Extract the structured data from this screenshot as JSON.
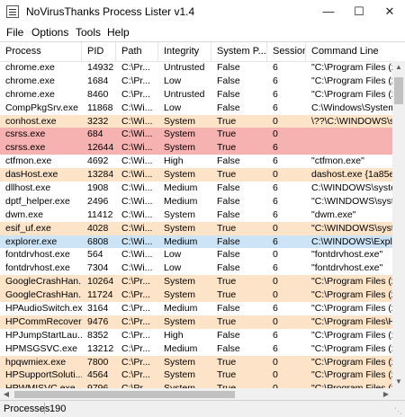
{
  "window": {
    "title": "NoVirusThanks Process Lister v1.4"
  },
  "menu": [
    "File",
    "Options",
    "Tools",
    "Help"
  ],
  "columns": [
    "Process",
    "PID",
    "Path",
    "Integrity",
    "System P...",
    "Session",
    "Command Line"
  ],
  "rows": [
    {
      "cells": [
        "chrome.exe",
        "14932",
        "C:\\Pr...",
        "Untrusted",
        "False",
        "6",
        "\"C:\\Program Files (x8"
      ],
      "hl": ""
    },
    {
      "cells": [
        "chrome.exe",
        "1684",
        "C:\\Pr...",
        "Low",
        "False",
        "6",
        "\"C:\\Program Files (x8"
      ],
      "hl": ""
    },
    {
      "cells": [
        "chrome.exe",
        "8460",
        "C:\\Pr...",
        "Untrusted",
        "False",
        "6",
        "\"C:\\Program Files (x8"
      ],
      "hl": ""
    },
    {
      "cells": [
        "CompPkgSrv.exe",
        "11868",
        "C:\\Wi...",
        "Low",
        "False",
        "6",
        "C:\\Windows\\System"
      ],
      "hl": ""
    },
    {
      "cells": [
        "conhost.exe",
        "3232",
        "C:\\Wi...",
        "System",
        "True",
        "0",
        "\\??\\C:\\WINDOWS\\sy"
      ],
      "hl": "orange"
    },
    {
      "cells": [
        "csrss.exe",
        "684",
        "C:\\Wi...",
        "System",
        "True",
        "0",
        ""
      ],
      "hl": "red"
    },
    {
      "cells": [
        "csrss.exe",
        "12644",
        "C:\\Wi...",
        "System",
        "True",
        "6",
        ""
      ],
      "hl": "red"
    },
    {
      "cells": [
        "ctfmon.exe",
        "4692",
        "C:\\Wi...",
        "High",
        "False",
        "6",
        "\"ctfmon.exe\""
      ],
      "hl": ""
    },
    {
      "cells": [
        "dasHost.exe",
        "13284",
        "C:\\Wi...",
        "System",
        "True",
        "0",
        "dashost.exe {1a85e"
      ],
      "hl": "orange"
    },
    {
      "cells": [
        "dllhost.exe",
        "1908",
        "C:\\Wi...",
        "Medium",
        "False",
        "6",
        "C:\\WINDOWS\\syster"
      ],
      "hl": ""
    },
    {
      "cells": [
        "dptf_helper.exe",
        "2496",
        "C:\\Wi...",
        "Medium",
        "False",
        "6",
        "\"C:\\WINDOWS\\syster"
      ],
      "hl": ""
    },
    {
      "cells": [
        "dwm.exe",
        "11412",
        "C:\\Wi...",
        "System",
        "False",
        "6",
        "\"dwm.exe\""
      ],
      "hl": ""
    },
    {
      "cells": [
        "esif_uf.exe",
        "4028",
        "C:\\Wi...",
        "System",
        "True",
        "0",
        "\"C:\\WINDOWS\\syster"
      ],
      "hl": "orange"
    },
    {
      "cells": [
        "explorer.exe",
        "6808",
        "C:\\Wi...",
        "Medium",
        "False",
        "6",
        "C:\\WINDOWS\\Explor"
      ],
      "hl": "blue"
    },
    {
      "cells": [
        "fontdrvhost.exe",
        "564",
        "C:\\Wi...",
        "Low",
        "False",
        "0",
        "\"fontdrvhost.exe\""
      ],
      "hl": ""
    },
    {
      "cells": [
        "fontdrvhost.exe",
        "7304",
        "C:\\Wi...",
        "Low",
        "False",
        "6",
        "\"fontdrvhost.exe\""
      ],
      "hl": ""
    },
    {
      "cells": [
        "GoogleCrashHan...",
        "10264",
        "C:\\Pr...",
        "System",
        "True",
        "0",
        "\"C:\\Program Files (x8"
      ],
      "hl": "orange"
    },
    {
      "cells": [
        "GoogleCrashHan...",
        "11724",
        "C:\\Pr...",
        "System",
        "True",
        "0",
        "\"C:\\Program Files (x8"
      ],
      "hl": "orange"
    },
    {
      "cells": [
        "HPAudioSwitch.exe",
        "3164",
        "C:\\Pr...",
        "Medium",
        "False",
        "6",
        "\"C:\\Program Files (x8"
      ],
      "hl": ""
    },
    {
      "cells": [
        "HPCommRecover...",
        "9476",
        "C:\\Pr...",
        "System",
        "True",
        "0",
        "\"C:\\Program Files\\HP"
      ],
      "hl": "orange"
    },
    {
      "cells": [
        "HPJumpStartLau...",
        "8352",
        "C:\\Pr...",
        "High",
        "False",
        "6",
        "\"C:\\Program Files (x8"
      ],
      "hl": ""
    },
    {
      "cells": [
        "HPMSGSVC.exe",
        "13212",
        "C:\\Pr...",
        "Medium",
        "False",
        "6",
        "\"C:\\Program Files (x8"
      ],
      "hl": ""
    },
    {
      "cells": [
        "hpqwmiex.exe",
        "7800",
        "C:\\Pr...",
        "System",
        "True",
        "0",
        "\"C:\\Program Files (x8"
      ],
      "hl": "orange"
    },
    {
      "cells": [
        "HPSupportSoluti...",
        "4564",
        "C:\\Pr...",
        "System",
        "True",
        "0",
        "\"C:\\Program Files (x8"
      ],
      "hl": "orange"
    },
    {
      "cells": [
        "HPWMISVC.exe",
        "9796",
        "C:\\Pr...",
        "System",
        "True",
        "0",
        "\"C:\\Program Files (x8"
      ],
      "hl": "orange"
    }
  ],
  "status": {
    "label": "Processes",
    "count": "190"
  }
}
